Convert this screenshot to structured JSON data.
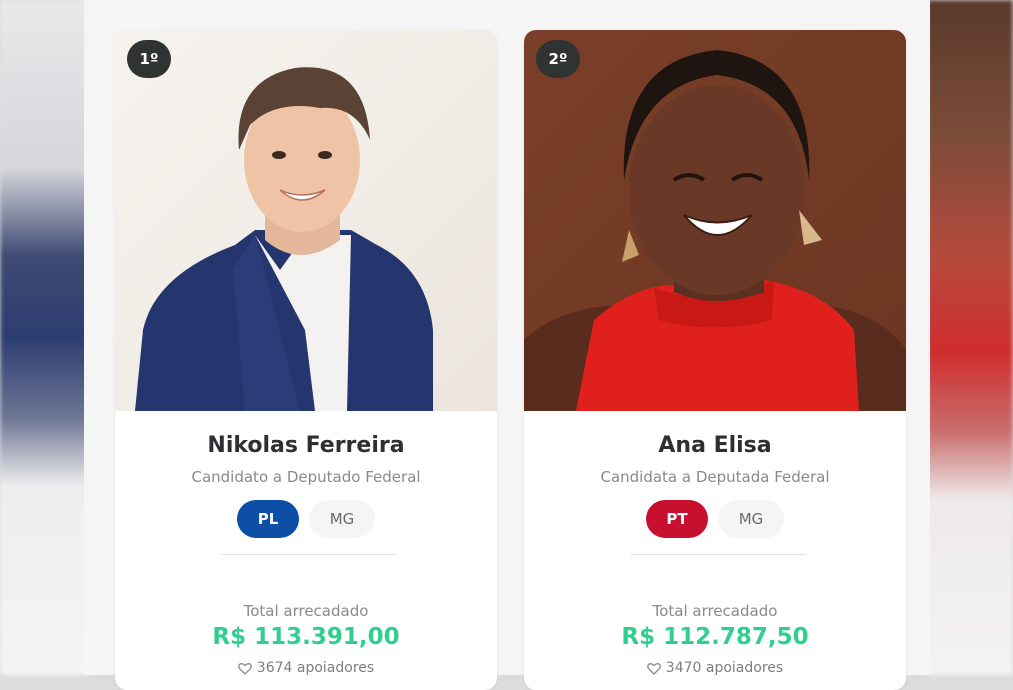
{
  "colors": {
    "pl": "#0d4ea6",
    "pt": "#c8102e",
    "amount": "#2fcf8e"
  },
  "candidates": [
    {
      "rank": "1º",
      "name": "Nikolas Ferreira",
      "role": "Candidato a Deputado Federal",
      "party": "PL",
      "state": "MG",
      "total_label": "Total arrecadado",
      "amount": "R$ 113.391,00",
      "supporters": "3674 apoiadores",
      "heart_icon": "heart-outline-icon"
    },
    {
      "rank": "2º",
      "name": "Ana Elisa",
      "role": "Candidata a Deputada Federal",
      "party": "PT",
      "state": "MG",
      "total_label": "Total arrecadado",
      "amount": "R$ 112.787,50",
      "supporters": "3470 apoiadores",
      "heart_icon": "heart-outline-icon"
    }
  ]
}
